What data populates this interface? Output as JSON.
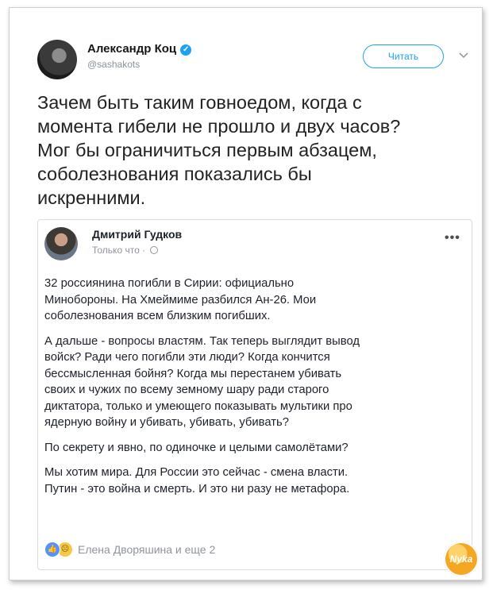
{
  "tweet": {
    "author_name": "Александр Коц",
    "author_handle": "@sashakots",
    "follow_label": "Читать",
    "text_lines": [
      "Зачем быть таким говноедом, когда с",
      "момента гибели не прошло и двух часов?",
      "Мог бы ограничиться первым абзацем,",
      "соболезнования показались бы",
      "искренними."
    ]
  },
  "embed": {
    "author_name": "Дмитрий Гудков",
    "timestamp": "Только что",
    "more_label": "•••",
    "paragraphs": [
      [
        "32 россиянина погибли в Сирии: официально",
        "Минобороны. На Хмеймиме разбился Ан-26. Мои",
        "соболезнования всем близким погибших."
      ],
      [
        "А дальше - вопросы властям. Так теперь выглядит вывод",
        "войск? Ради чего погибли эти люди? Когда кончится",
        "бессмысленная бойня? Когда мы перестанем убивать",
        "своих и чужих по всему земному шару ради старого",
        "диктатора, только и умеющего показывать мультики про",
        "ядерную войну и убивать, убивать, убивать?"
      ],
      [
        "По секрету и явно, по одиночке и целыми самолётами?"
      ],
      [
        "Мы хотим мира. Для России это сейчас - смена власти.",
        "Путин - это война и смерть. И это ни разу не метафора."
      ]
    ],
    "reactions_text": "Елена Дворяшина и еще 2"
  },
  "watermark": {
    "text": "Nyka"
  },
  "colors": {
    "accent": "#1da1f2",
    "fb_like": "#5890ff",
    "fb_meta": "#90949c"
  },
  "icons": [
    "verified-icon",
    "chevron-down-icon",
    "globe-icon",
    "more-icon",
    "like-icon",
    "sad-icon"
  ]
}
